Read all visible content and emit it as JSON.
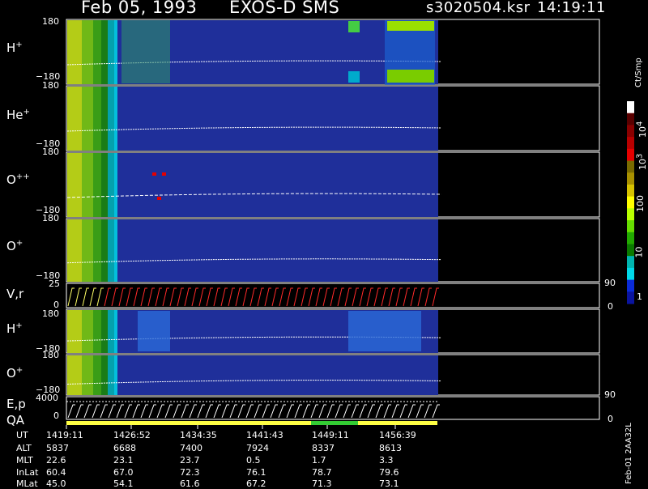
{
  "header": {
    "date": "Feb 05, 1993",
    "instrument": "EXOS-D SMS",
    "file": "s3020504.ksr",
    "time": "14:19:11"
  },
  "colors": {
    "background": "#000000",
    "panel_bg": "#1f2f9a",
    "trace": "#ffffff",
    "velocity_trace_early": "#ffff66",
    "velocity_trace_late": "#ff2a2a",
    "qa_bar_main": "#ffff44",
    "qa_bar_segment": "#33cc33"
  },
  "panels": [
    {
      "id": "h-plus-top",
      "label": "H",
      "sup": "+",
      "ymax": "180",
      "ymin": "−180"
    },
    {
      "id": "he-plus",
      "label": "He",
      "sup": "+",
      "ymax": "180",
      "ymin": "−180"
    },
    {
      "id": "o-plus-plus",
      "label": "O",
      "sup": "++",
      "ymax": "180",
      "ymin": "−180"
    },
    {
      "id": "o-plus-top",
      "label": "O",
      "sup": "+",
      "ymax": "180",
      "ymin": "−180"
    },
    {
      "id": "velocity",
      "label": "V,r",
      "sup": "",
      "ymax": "25",
      "ymin": "0",
      "right_top": "90",
      "right_bottom": "0"
    },
    {
      "id": "h-plus-bottom",
      "label": "H",
      "sup": "+",
      "ymax": "180",
      "ymin": "−180"
    },
    {
      "id": "o-plus-bottom",
      "label": "O",
      "sup": "+",
      "ymax": "180",
      "ymin": "−180"
    },
    {
      "id": "energy",
      "label": "E,p",
      "label2": "QA",
      "sup": "",
      "ymax": "4000",
      "ymin": "0",
      "right_top": "90",
      "right_bottom": "0"
    }
  ],
  "colorbar": {
    "unit": "Ct/Smp",
    "ticks": [
      "10",
      "3",
      "100",
      "10",
      "1"
    ],
    "tick_sups": [
      "4",
      "",
      "",
      "",
      ""
    ],
    "tick_prefix": [
      "10",
      "10",
      "100",
      "10",
      "1"
    ],
    "tick_exps": [
      "4",
      "3",
      "",
      "",
      ""
    ],
    "colors": [
      "#ffffff",
      "#5a0000",
      "#8a0000",
      "#b80000",
      "#e60000",
      "#7a6b00",
      "#a89000",
      "#d6c200",
      "#ffff00",
      "#b8ff00",
      "#66dd00",
      "#22aa00",
      "#0b7a00",
      "#00b5b0",
      "#00d8e8",
      "#0a2bd8",
      "#0a14a0"
    ]
  },
  "table": {
    "row_labels": [
      "UT",
      "ALT",
      "MLT",
      "InLat",
      "MLat"
    ],
    "columns": [
      [
        "1419:11",
        "5837",
        "22.6",
        "60.4",
        "45.0"
      ],
      [
        "1426:52",
        "6688",
        "23.1",
        "67.0",
        "54.1"
      ],
      [
        "1434:35",
        "7400",
        "23.7",
        "72.3",
        "61.6"
      ],
      [
        "1441:43",
        "7924",
        "0.5",
        "76.1",
        "67.2"
      ],
      [
        "1449:11",
        "8337",
        "1.7",
        "78.7",
        "71.3"
      ],
      [
        "1456:39",
        "8613",
        "3.3",
        "79.6",
        "73.1"
      ]
    ]
  },
  "footer_id": "Feb-01 2AA32L",
  "chart_data": {
    "type": "heatmap",
    "title": "Feb 05, 1993   EXOS-D SMS",
    "x": [
      "1419:11",
      "1426:52",
      "1434:35",
      "1441:43",
      "1449:11",
      "1456:39"
    ],
    "xlabel": "UT",
    "colorbar_label": "Ct/Smp",
    "colorbar_range": [
      1,
      10000
    ],
    "colorbar_scale": "log",
    "series": [
      {
        "name": "H+",
        "ylim": [
          -180,
          180
        ]
      },
      {
        "name": "He+",
        "ylim": [
          -180,
          180
        ]
      },
      {
        "name": "O++",
        "ylim": [
          -180,
          180
        ]
      },
      {
        "name": "O+",
        "ylim": [
          -180,
          180
        ]
      },
      {
        "name": "V,r",
        "ylim": [
          0,
          25
        ],
        "right_ylim": [
          0,
          90
        ]
      },
      {
        "name": "H+",
        "ylim": [
          -180,
          180
        ]
      },
      {
        "name": "O+",
        "ylim": [
          -180,
          180
        ]
      },
      {
        "name": "E,p",
        "ylim": [
          0,
          4000
        ],
        "right_ylim": [
          0,
          90
        ]
      }
    ],
    "grid": false,
    "legend": "right"
  }
}
